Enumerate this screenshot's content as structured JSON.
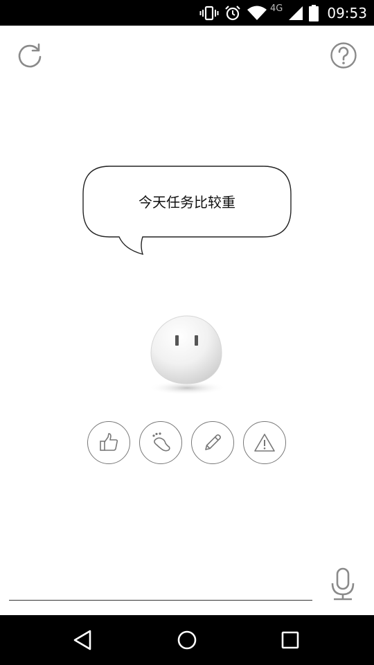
{
  "status_bar": {
    "time": "09:53",
    "network_label": "4G",
    "icons": [
      "vibrate-icon",
      "alarm-icon",
      "wifi-icon",
      "signal-icon",
      "battery-icon"
    ]
  },
  "header": {
    "left_icon": "refresh-icon",
    "right_icon": "help-icon"
  },
  "speech_bubble": {
    "text": "今天任务比较重"
  },
  "actions": [
    {
      "icon": "thumbs-up-icon"
    },
    {
      "icon": "footprint-icon"
    },
    {
      "icon": "pencil-icon"
    },
    {
      "icon": "warning-icon"
    }
  ],
  "input": {
    "mic_icon": "microphone-icon"
  },
  "nav_bar": {
    "icons": [
      "back-icon",
      "home-icon",
      "recents-icon"
    ]
  }
}
